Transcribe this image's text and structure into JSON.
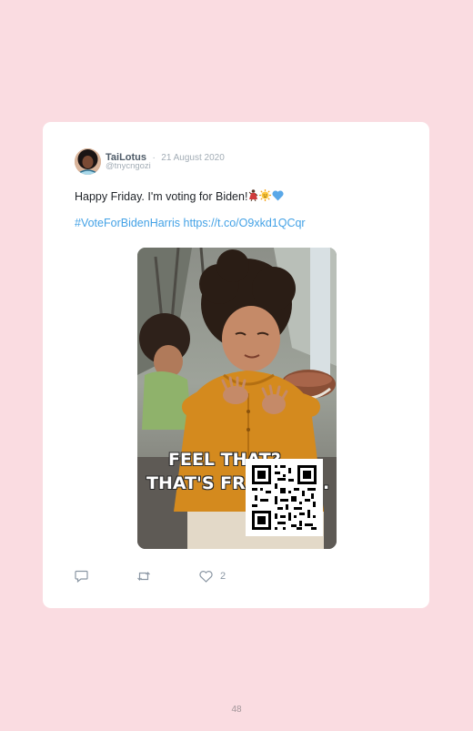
{
  "tweet": {
    "author_name": "TaiLotus",
    "separator": "·",
    "date": "21 August 2020",
    "handle": "@tnycngozi",
    "text": "Happy Friday. I'm voting for Biden!",
    "emojis": [
      "woman-dancing",
      "sun-with-face",
      "blue-heart"
    ],
    "hashtag": "#VoteForBidenHarris",
    "link": "https://t.co/O9xkd1QCqr",
    "media": {
      "caption_line1": "FEEL THAT?",
      "caption_line2": "THAT'S FR",
      "caption_line2_tail": "."
    },
    "actions": {
      "reply_icon": "reply-icon",
      "retweet_icon": "retweet-icon",
      "like_icon": "heart-icon",
      "like_count": "2"
    }
  },
  "page": {
    "number": "48"
  },
  "colors": {
    "background": "#fadce1",
    "card": "#ffffff",
    "link": "#44a2e6",
    "muted": "#a3adb6"
  }
}
